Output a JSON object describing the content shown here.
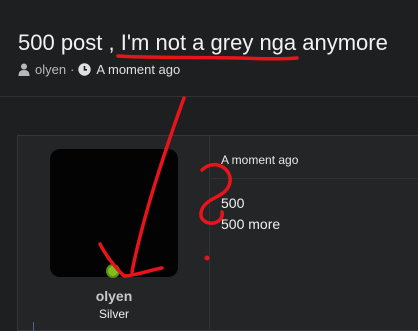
{
  "thread": {
    "title": "500 post , I'm not a grey nga anymore",
    "author": "olyen",
    "separator": "·",
    "time": "A moment ago"
  },
  "post": {
    "author": "olyen",
    "rank": "Silver",
    "date": "A moment ago",
    "body_lines": [
      "500",
      "500 more"
    ]
  },
  "colors": {
    "background": "#1d1f21",
    "online_status": "#7fbe20",
    "annotation": "#e8141b"
  },
  "icons": {
    "author": "user-icon",
    "time": "clock-icon"
  }
}
